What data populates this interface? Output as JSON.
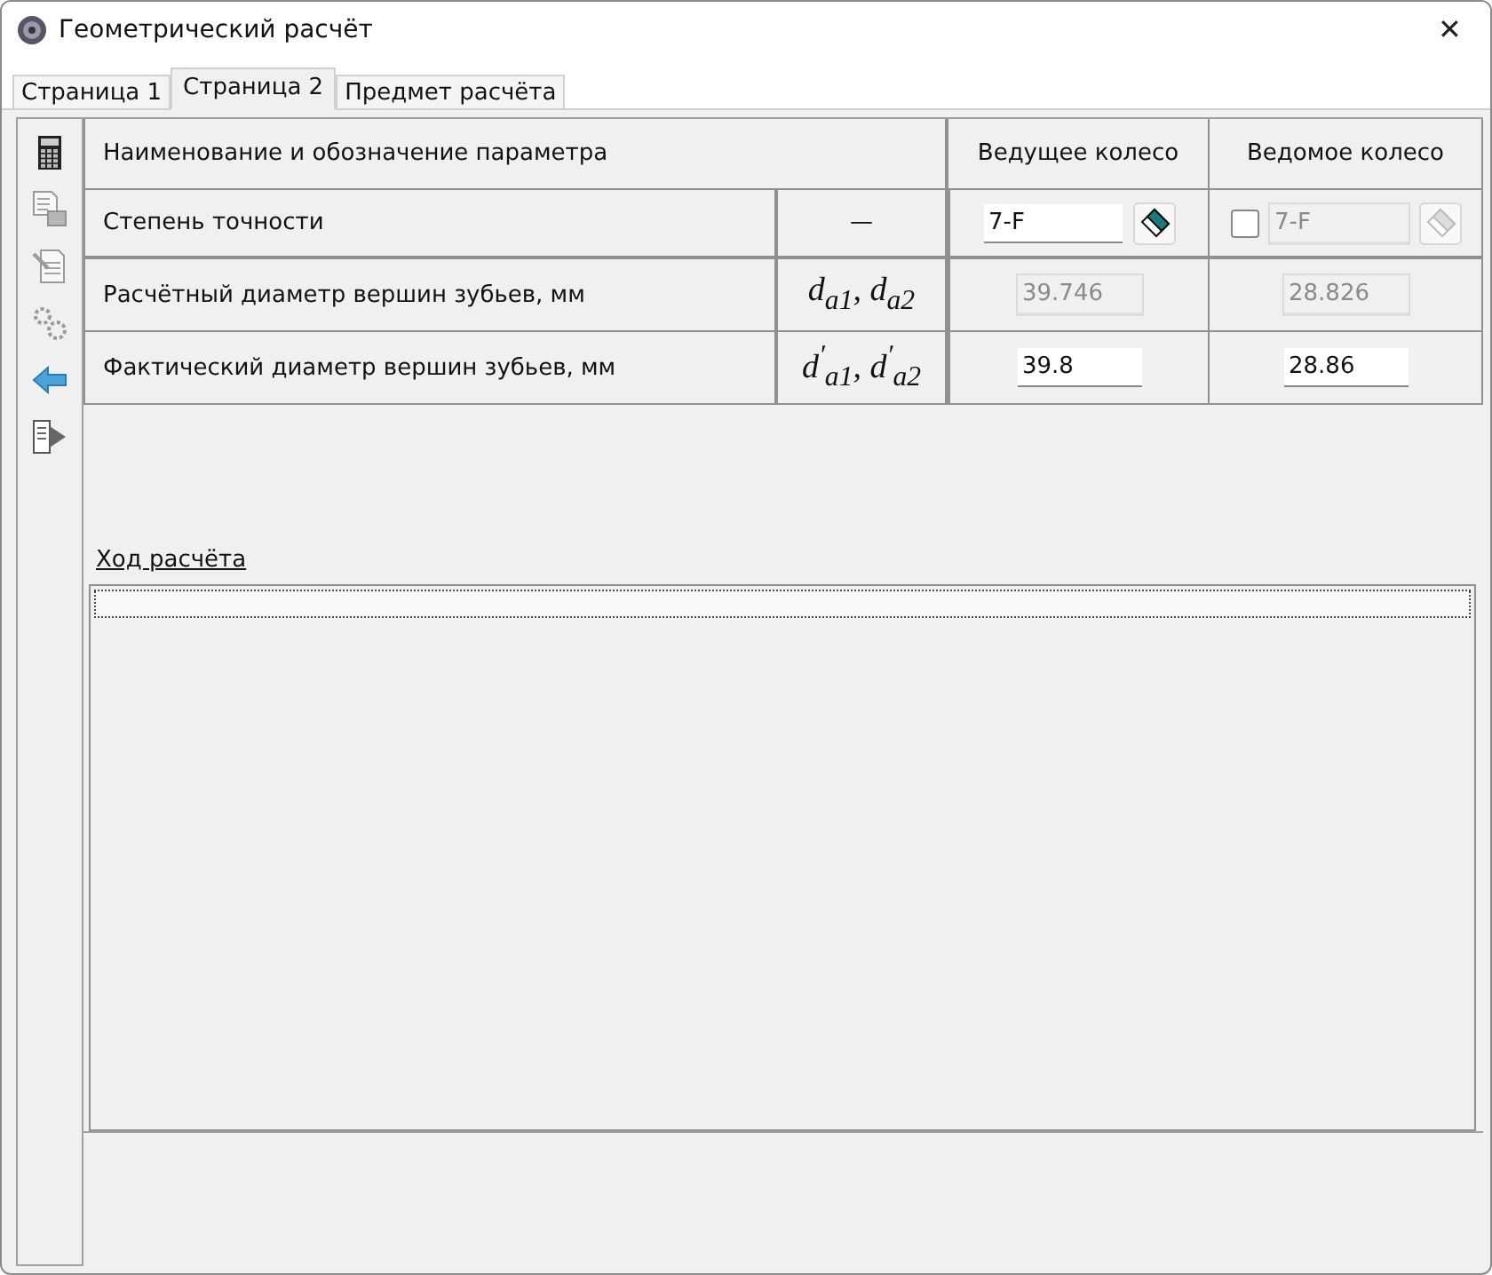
{
  "window": {
    "title": "Геометрический расчёт",
    "close": "✕"
  },
  "tabs": [
    {
      "label": "Страница 1",
      "selected": false
    },
    {
      "label": "Страница 2",
      "selected": true
    },
    {
      "label": "Предмет расчёта",
      "selected": false
    }
  ],
  "toolbar": [
    {
      "kind": "calculator",
      "disabled": false
    },
    {
      "kind": "print",
      "disabled": true
    },
    {
      "kind": "document",
      "disabled": true
    },
    {
      "kind": "gears",
      "disabled": true
    },
    {
      "kind": "back",
      "disabled": false
    },
    {
      "kind": "export",
      "disabled": false
    }
  ],
  "table": {
    "columns": [
      "Наименование и обозначение параметра",
      "Ведущее колесо",
      "Ведомое колесо"
    ],
    "rows": [
      {
        "kind": "accuracy",
        "name": "Степень точности",
        "symbol": "—",
        "driver": {
          "value": "7-F",
          "disabled": false
        },
        "driven": {
          "value": "7-F",
          "disabled": true,
          "checked": false
        }
      },
      {
        "kind": "values",
        "name": "Расчётный диаметр вершин зубьев, мм",
        "symbol": "d$_{a1}$, d$_{a2}$",
        "driver": {
          "value": "39.746",
          "disabled": true
        },
        "driven": {
          "value": "28.826",
          "disabled": true
        }
      },
      {
        "kind": "values",
        "name": "Фактический диаметр вершин зубьев, мм",
        "symbol": "d$^{′}$$_{a1}$, d$^{′}$$_{a2}$",
        "driver": {
          "value": "39.8",
          "disabled": false
        },
        "driven": {
          "value": "28.86",
          "disabled": false
        }
      }
    ]
  },
  "log": {
    "link": "Ход расчёта"
  }
}
